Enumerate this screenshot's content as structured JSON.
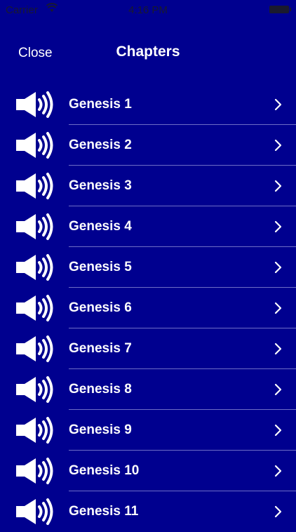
{
  "status_bar": {
    "carrier": "Carrier",
    "time": "4:16 PM"
  },
  "nav": {
    "close_label": "Close",
    "title": "Chapters"
  },
  "chapters": [
    {
      "label": "Genesis 1"
    },
    {
      "label": "Genesis 2"
    },
    {
      "label": "Genesis 3"
    },
    {
      "label": "Genesis 4"
    },
    {
      "label": "Genesis 5"
    },
    {
      "label": "Genesis 6"
    },
    {
      "label": "Genesis 7"
    },
    {
      "label": "Genesis 8"
    },
    {
      "label": "Genesis 9"
    },
    {
      "label": "Genesis 10"
    },
    {
      "label": "Genesis 11"
    }
  ],
  "icons": {
    "row_icon": "speaker-icon",
    "row_accessory": "chevron-right-icon"
  },
  "colors": {
    "background": "#00008f",
    "text": "#ffffff",
    "separator": "#6d6dc6"
  }
}
